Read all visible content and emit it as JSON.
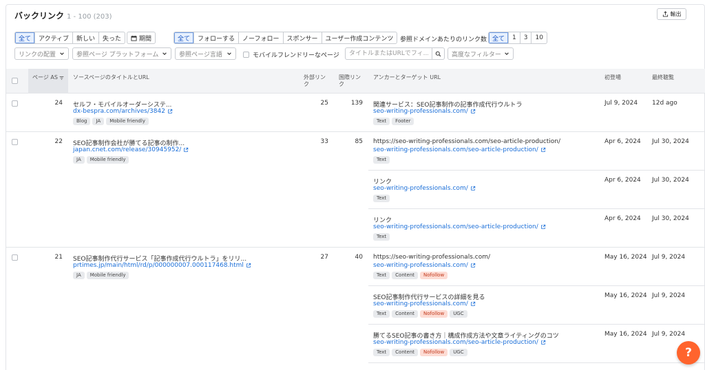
{
  "header": {
    "title": "バックリンク",
    "count": "1 - 100 (203)",
    "export_label": "輸出"
  },
  "filters": {
    "status_tabs": [
      "全て",
      "アクティブ",
      "新しい",
      "失った"
    ],
    "period_label": "期間",
    "follow_tabs": [
      "全て",
      "フォローする",
      "ノーフォロー",
      "スポンサー",
      "ユーザー作成コンテンツ"
    ],
    "links_per_domain_label": "参照ドメインあたりのリンク数",
    "links_per_domain_tabs": [
      "全て",
      "1",
      "3",
      "10"
    ],
    "link_placement": "リンクの配置",
    "platform": "参照ページ プラットフォーム",
    "language": "参照ページ言語",
    "mobile_friendly_label": "モバイルフレンドリーなページ",
    "search_placeholder": "タイトルまたはURLでフィ...",
    "advanced_filter": "高度なフィルター"
  },
  "table": {
    "columns": {
      "page_as": "ページ AS",
      "source": "ソースページのタイトルとURL",
      "external_links": "外部リンク",
      "internal_links": "国際リンク",
      "anchor_target": "アンカーとターゲット URL",
      "first_seen": "初登場",
      "last_seen": "最終聴覧"
    },
    "rows": [
      {
        "as": "24",
        "title": "セルフ・モバイルオーダーシステ...",
        "url": "dx-bespra.com/archives/3842",
        "tags": [
          "Blog",
          "JA",
          "Mobile friendly"
        ],
        "external": "25",
        "internal": "139",
        "anchors": [
          {
            "text": "関連サービス：SEO記事制作の記事作成代行ウルトラ",
            "url": "seo-writing-professionals.com/",
            "tags": [
              "Text",
              "Footer"
            ],
            "first": "Jul 9, 2024",
            "last": "12d ago"
          }
        ]
      },
      {
        "as": "22",
        "title": "SEO記事制作会社が勝てる記事の制作...",
        "url": "japan.cnet.com/release/30945952/",
        "tags": [
          "JA",
          "Mobile friendly"
        ],
        "external": "33",
        "internal": "85",
        "anchors": [
          {
            "text": "https://seo-writing-professionals.com/seo-article-production/",
            "url": "seo-writing-professionals.com/seo-article-production/",
            "tags": [
              "Text"
            ],
            "first": "Apr 6, 2024",
            "last": "Jul 30, 2024"
          },
          {
            "text": "リンク",
            "url": "seo-writing-professionals.com/",
            "tags": [
              "Text"
            ],
            "first": "Apr 6, 2024",
            "last": "Jul 30, 2024"
          },
          {
            "text": "リンク",
            "url": "seo-writing-professionals.com/seo-article-production/",
            "tags": [
              "Text"
            ],
            "first": "Apr 6, 2024",
            "last": "Jul 30, 2024"
          }
        ]
      },
      {
        "as": "21",
        "title": "SEO記事制作代行サービス「記事作成代行ウルトラ」をリリ...",
        "url": "prtimes.jp/main/html/rd/p/000000007.000117468.html",
        "tags": [
          "JA",
          "Mobile friendly"
        ],
        "external": "27",
        "internal": "40",
        "anchors": [
          {
            "text": "https://seo-writing-professionals.com/",
            "url": "seo-writing-professionals.com/",
            "tags": [
              "Text",
              "Content",
              "Nofollow"
            ],
            "first": "May 16, 2024",
            "last": "Jul 9, 2024"
          },
          {
            "text": "SEO記事制作代行サービスの詳細を見る",
            "url": "seo-writing-professionals.com/",
            "tags": [
              "Text",
              "Content",
              "Nofollow",
              "UGC"
            ],
            "first": "May 16, 2024",
            "last": "Jul 9, 2024"
          },
          {
            "text": "勝てるSEO記事の書き方｜構成作成方法や文章ライティングのコツ",
            "url": "seo-writing-professionals.com/seo-article-production/",
            "tags": [
              "Text",
              "Content",
              "Nofollow",
              "UGC"
            ],
            "first": "May 16, 2024",
            "last": "Jul 9, 2024"
          }
        ]
      }
    ]
  },
  "help_label": "?",
  "colors": {
    "accent": "#1a6ed8",
    "help": "#ff642d",
    "nofollow": "#c2391b"
  }
}
